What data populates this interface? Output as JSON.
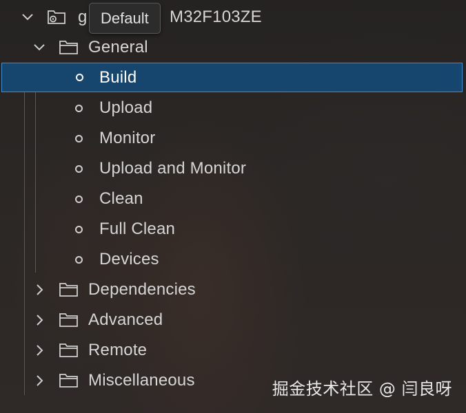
{
  "project": {
    "label_prefix": "g",
    "label_suffix": "M32F103ZE",
    "icon": "project-icon",
    "expanded": true
  },
  "tooltip": {
    "text": "Default"
  },
  "general": {
    "label": "General",
    "icon": "folder-icon",
    "expanded": true,
    "tasks": [
      {
        "label": "Build",
        "icon": "circle-icon",
        "selected": true
      },
      {
        "label": "Upload",
        "icon": "circle-icon"
      },
      {
        "label": "Monitor",
        "icon": "circle-icon"
      },
      {
        "label": "Upload and Monitor",
        "icon": "circle-icon"
      },
      {
        "label": "Clean",
        "icon": "circle-icon"
      },
      {
        "label": "Full Clean",
        "icon": "circle-icon"
      },
      {
        "label": "Devices",
        "icon": "circle-icon"
      }
    ]
  },
  "folders": [
    {
      "label": "Dependencies",
      "icon": "folder-icon",
      "expanded": false
    },
    {
      "label": "Advanced",
      "icon": "folder-icon",
      "expanded": false
    },
    {
      "label": "Remote",
      "icon": "folder-icon",
      "expanded": false
    },
    {
      "label": "Miscellaneous",
      "icon": "folder-icon",
      "expanded": false
    }
  ],
  "watermark": {
    "text": "掘金技术社区 @ 闫良呀"
  },
  "colors": {
    "selection_bg": "#16466e",
    "selection_border": "#3b8fd6",
    "text": "#d6d6d6"
  }
}
